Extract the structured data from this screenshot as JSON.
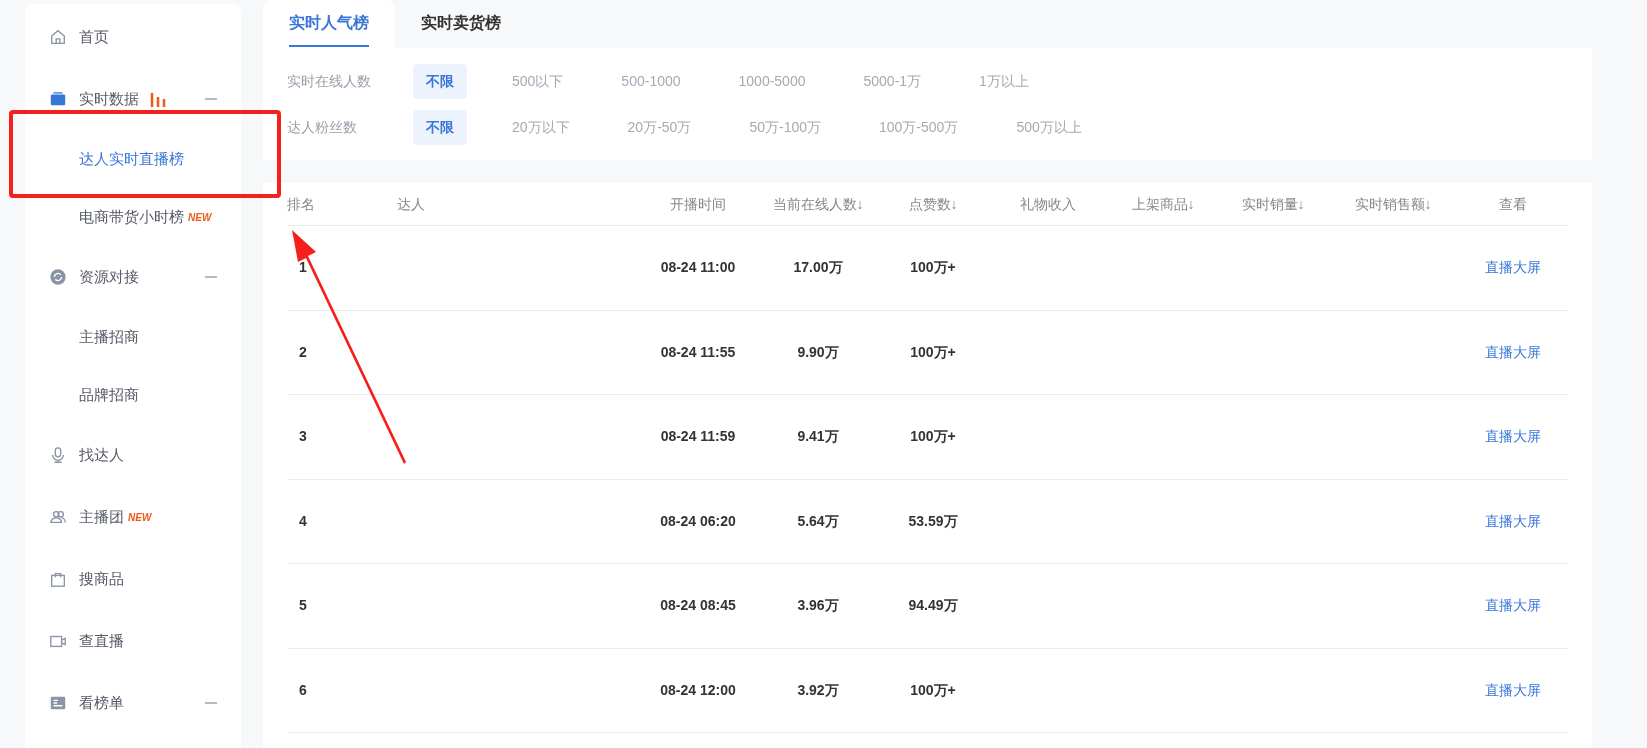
{
  "sidebar": {
    "items": [
      {
        "kind": "item",
        "label": "首页",
        "selected": false
      },
      {
        "kind": "group",
        "label": "实时数据",
        "expanded": true,
        "children": [
          {
            "label": "达人实时直播榜",
            "selected": true
          },
          {
            "label": "电商带货小时榜",
            "selected": false,
            "badge": "NEW"
          }
        ]
      },
      {
        "kind": "group",
        "label": "资源对接",
        "expanded": true,
        "children": [
          {
            "label": "主播招商",
            "selected": false
          },
          {
            "label": "品牌招商",
            "selected": false
          }
        ]
      },
      {
        "kind": "item",
        "label": "找达人",
        "selected": false
      },
      {
        "kind": "item",
        "label": "主播团",
        "selected": false,
        "badge": "NEW"
      },
      {
        "kind": "item",
        "label": "搜商品",
        "selected": false
      },
      {
        "kind": "item",
        "label": "查直播",
        "selected": false
      },
      {
        "kind": "group",
        "label": "看榜单",
        "expanded": true
      }
    ]
  },
  "tabs": [
    {
      "label": "实时人气榜",
      "selected": true
    },
    {
      "label": "实时卖货榜",
      "selected": false
    }
  ],
  "filters": [
    {
      "label": "实时在线人数",
      "options": [
        {
          "label": "不限",
          "selected": true
        },
        {
          "label": "500以下",
          "selected": false
        },
        {
          "label": "500-1000",
          "selected": false
        },
        {
          "label": "1000-5000",
          "selected": false
        },
        {
          "label": "5000-1万",
          "selected": false
        },
        {
          "label": "1万以上",
          "selected": false
        }
      ]
    },
    {
      "label": "达人粉丝数",
      "options": [
        {
          "label": "不限",
          "selected": true
        },
        {
          "label": "20万以下",
          "selected": false
        },
        {
          "label": "20万-50万",
          "selected": false
        },
        {
          "label": "50万-100万",
          "selected": false
        },
        {
          "label": "100万-500万",
          "selected": false
        },
        {
          "label": "500万以上",
          "selected": false
        }
      ]
    }
  ],
  "table": {
    "columns": [
      "排名",
      "达人",
      "开播时间",
      "当前在线人数↓",
      "点赞数↓",
      "礼物收入",
      "上架商品↓",
      "实时销量↓",
      "实时销售额↓",
      "查看"
    ],
    "rows": [
      {
        "rank": "1",
        "start": "08-24 11:00",
        "online": "17.00万",
        "likes": "100万+",
        "action": "直播大屏"
      },
      {
        "rank": "2",
        "start": "08-24 11:55",
        "online": "9.90万",
        "likes": "100万+",
        "action": "直播大屏"
      },
      {
        "rank": "3",
        "start": "08-24 11:59",
        "online": "9.41万",
        "likes": "100万+",
        "action": "直播大屏"
      },
      {
        "rank": "4",
        "start": "08-24 06:20",
        "online": "5.64万",
        "likes": "53.59万",
        "action": "直播大屏"
      },
      {
        "rank": "5",
        "start": "08-24 08:45",
        "online": "3.96万",
        "likes": "94.49万",
        "action": "直播大屏"
      },
      {
        "rank": "6",
        "start": "08-24 12:00",
        "online": "3.92万",
        "likes": "100万+",
        "action": "直播大屏"
      }
    ]
  }
}
